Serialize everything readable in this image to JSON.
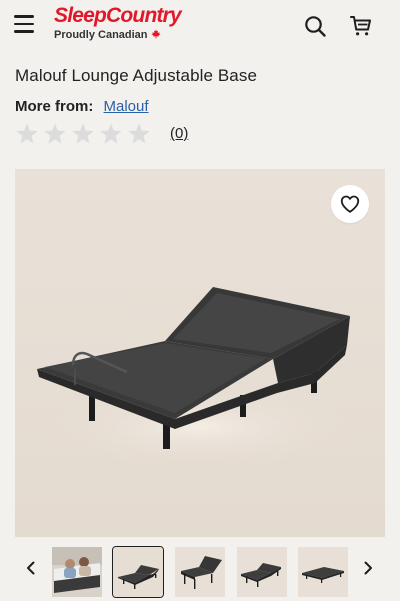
{
  "header": {
    "logo_text": "SleepCountry",
    "logo_tagline": "Proudly Canadian",
    "icons": [
      "menu-icon",
      "search-icon",
      "cart-icon",
      "maple-leaf-icon"
    ],
    "brand_color": "#e2182a"
  },
  "product": {
    "title": "Malouf Lounge Adjustable Base",
    "brand_label": "More from:",
    "brand_name": "Malouf",
    "rating": 0,
    "rating_max": 5,
    "review_count": "(0)"
  },
  "gallery": {
    "favorite_icon": "heart-icon",
    "thumbnails": [
      {
        "name": "thumbnail-lifestyle",
        "selected": false
      },
      {
        "name": "thumbnail-base-front",
        "selected": true
      },
      {
        "name": "thumbnail-base-raised",
        "selected": false
      },
      {
        "name": "thumbnail-base-angle",
        "selected": false
      },
      {
        "name": "thumbnail-base-flat",
        "selected": false
      }
    ],
    "prev_icon": "chevron-left-icon",
    "next_icon": "chevron-right-icon"
  },
  "colors": {
    "link": "#2b5fa8",
    "star_empty": "#dcdcdc",
    "background": "#f3f1ee"
  }
}
